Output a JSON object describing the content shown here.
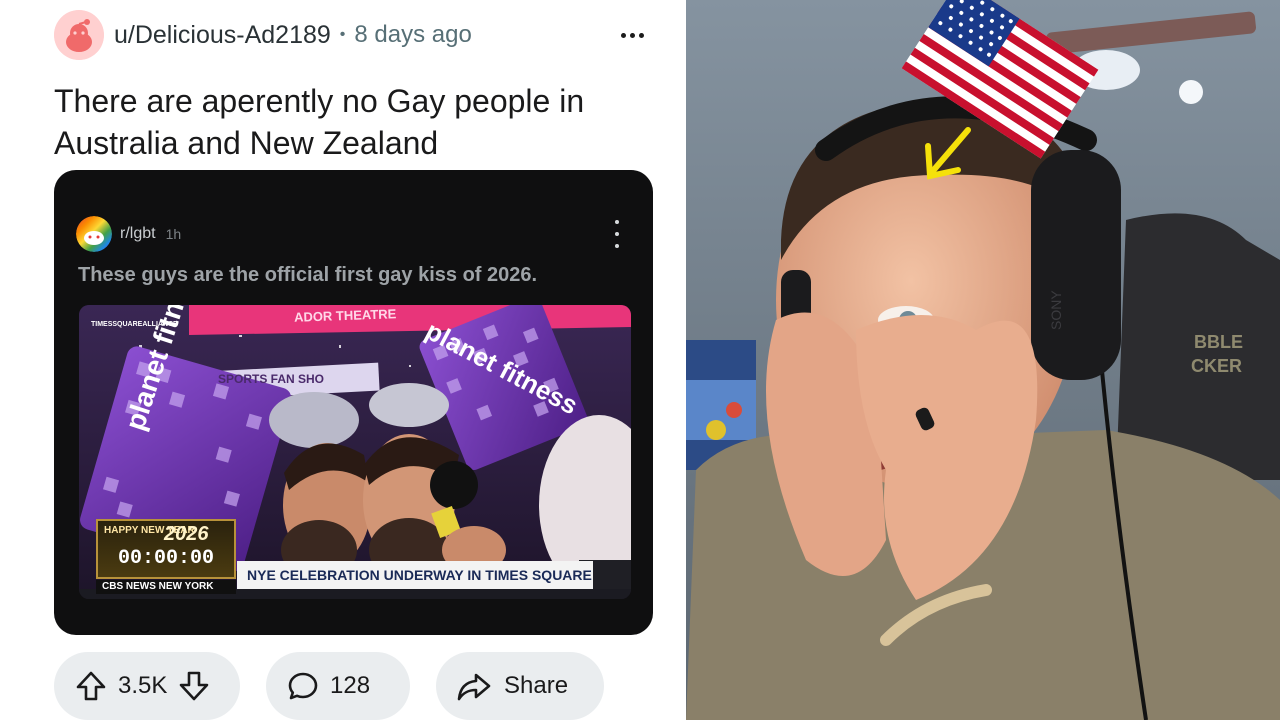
{
  "post": {
    "username": "u/Delicious-Ad2189",
    "separator": "•",
    "timestamp": "8 days ago",
    "title": "There are aperently no Gay people in Australia and New Zealand",
    "embed": {
      "subreddit": "r/lgbt",
      "time": "1h",
      "text": "These guys are the official first gay kiss of 2026.",
      "video": {
        "theatre_sign": "ADOR THEATRE",
        "alliance": "TIMESSQUAREALLIANCE",
        "sports_sign": "SPORTS FAN SHO",
        "brand_hat_1": "planet fitness",
        "brand_hat_2": "planet fitness",
        "badge_caption": "HAPPY NEW YEAR",
        "badge_year": "2026",
        "badge_clock": "00:00:00",
        "network": "CBS NEWS NEW YORK",
        "lower_third": "NYE CELEBRATION UNDERWAY IN TIMES SQUARE"
      }
    },
    "actions": {
      "votes": "3.5K",
      "comments": "128",
      "share": "Share"
    }
  },
  "reaction": {
    "headphone_brand": "SONY",
    "chair_text_1": "BBLE",
    "chair_text_2": "CKER"
  },
  "colors": {
    "page_bg": "#ffffff",
    "pill_bg": "#eaedef",
    "embed_bg": "#0f0f10",
    "arrow_yellow": "#f5e10a",
    "wall": "#6e7a86"
  }
}
